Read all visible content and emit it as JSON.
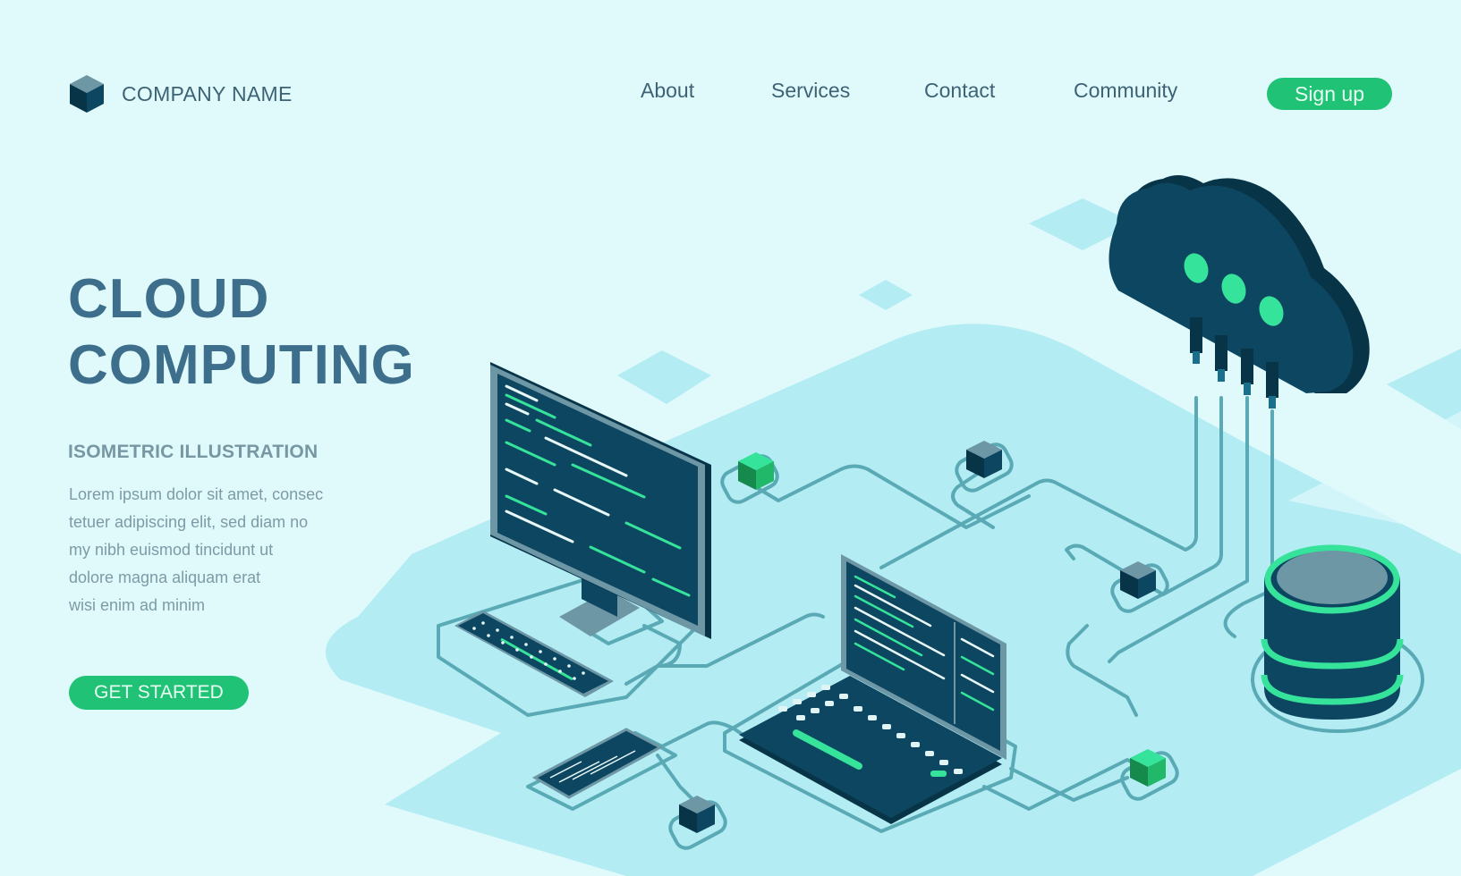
{
  "header": {
    "brand": {
      "logo_icon": "cube-icon",
      "name": "COMPANY NAME"
    },
    "nav": [
      {
        "label": "About"
      },
      {
        "label": "Services"
      },
      {
        "label": "Contact"
      },
      {
        "label": "Community"
      }
    ],
    "signup_label": "Sign up"
  },
  "hero": {
    "title_line1": "CLOUD",
    "title_line2": "COMPUTING",
    "subtitle": "ISOMETRIC ILLUSTRATION",
    "body_lines": [
      "Lorem ipsum dolor sit amet, consec",
      "tetuer adipiscing elit, sed diam no",
      "my nibh euismod tincidunt ut",
      "dolore magna aliquam erat",
      "wisi enim ad minim"
    ],
    "cta_label": "GET STARTED"
  },
  "illustration": {
    "elements": [
      "cloud-icon",
      "desktop-monitor-icon",
      "keyboard-icon",
      "laptop-icon",
      "smartphone-icon",
      "database-icon",
      "node-cube-icon"
    ]
  },
  "colors": {
    "background": "#e0fafc",
    "platform": "#b3ecf3",
    "accent_green": "#20c275",
    "neon_green": "#35e39a",
    "dark_navy": "#0d4660",
    "text_primary": "#3d6275",
    "title": "#3d6e8b",
    "circuit": "#5aaab6"
  }
}
